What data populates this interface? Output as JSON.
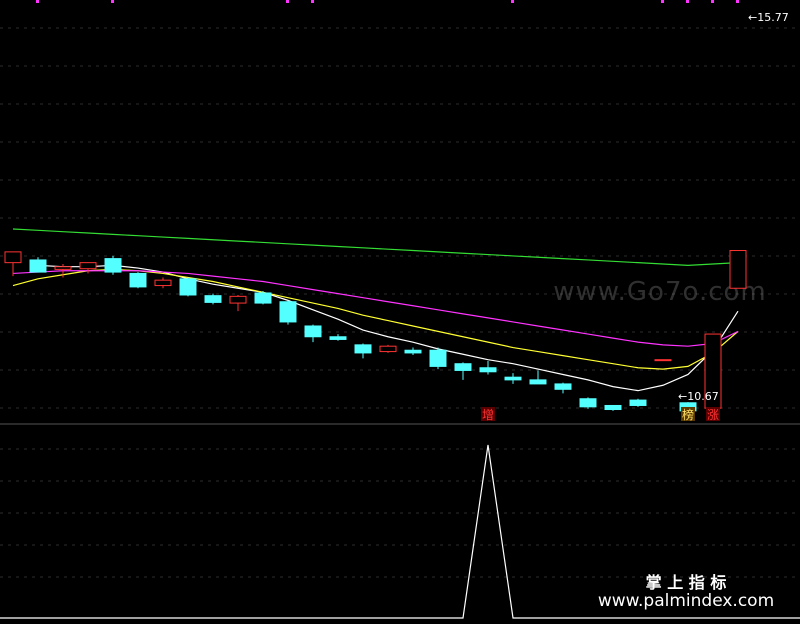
{
  "watermark": {
    "text": "www.Go7o.com"
  },
  "brand": {
    "name": "掌 上 指 标",
    "url": "www.palmindex.com"
  },
  "chart_data": [
    {
      "type": "candlestick",
      "panel": "price",
      "up_color": "#ff3333",
      "down_color": "#54ffff",
      "ylim": [
        10.2,
        15.9
      ],
      "x": [
        1,
        2,
        3,
        4,
        5,
        6,
        7,
        8,
        9,
        10,
        11,
        12,
        13,
        14,
        15,
        16,
        17,
        18,
        19,
        20,
        21,
        22,
        23,
        24,
        25,
        26,
        27,
        28,
        29,
        30
      ],
      "candles": [
        {
          "o": 12.12,
          "h": 12.2,
          "l": 11.92,
          "c": 12.28
        },
        {
          "o": 12.16,
          "h": 12.2,
          "l": 11.98,
          "c": 11.98
        },
        {
          "o": 12.02,
          "h": 12.1,
          "l": 11.9,
          "c": 12.06
        },
        {
          "o": 12.03,
          "h": 12.12,
          "l": 11.96,
          "c": 12.12
        },
        {
          "o": 12.18,
          "h": 12.22,
          "l": 11.94,
          "c": 11.98
        },
        {
          "o": 11.96,
          "h": 11.98,
          "l": 11.74,
          "c": 11.76
        },
        {
          "o": 11.78,
          "h": 11.9,
          "l": 11.74,
          "c": 11.86
        },
        {
          "o": 11.88,
          "h": 11.9,
          "l": 11.62,
          "c": 11.64
        },
        {
          "o": 11.63,
          "h": 11.66,
          "l": 11.5,
          "c": 11.53
        },
        {
          "o": 11.52,
          "h": 11.64,
          "l": 11.4,
          "c": 11.62
        },
        {
          "o": 11.67,
          "h": 11.7,
          "l": 11.5,
          "c": 11.52
        },
        {
          "o": 11.54,
          "h": 11.56,
          "l": 11.2,
          "c": 11.24
        },
        {
          "o": 11.18,
          "h": 11.2,
          "l": 10.94,
          "c": 11.02
        },
        {
          "o": 11.02,
          "h": 11.06,
          "l": 10.96,
          "c": 10.98
        },
        {
          "o": 10.9,
          "h": 10.92,
          "l": 10.7,
          "c": 10.78
        },
        {
          "o": 10.8,
          "h": 10.9,
          "l": 10.78,
          "c": 10.88
        },
        {
          "o": 10.82,
          "h": 10.86,
          "l": 10.75,
          "c": 10.78
        },
        {
          "o": 10.82,
          "h": 10.86,
          "l": 10.54,
          "c": 10.58
        },
        {
          "o": 10.62,
          "h": 10.64,
          "l": 10.38,
          "c": 10.52
        },
        {
          "o": 10.56,
          "h": 10.66,
          "l": 10.46,
          "c": 10.5
        },
        {
          "o": 10.42,
          "h": 10.48,
          "l": 10.32,
          "c": 10.38
        },
        {
          "o": 10.38,
          "h": 10.52,
          "l": 10.32,
          "c": 10.32
        },
        {
          "o": 10.32,
          "h": 10.34,
          "l": 10.18,
          "c": 10.24
        },
        {
          "o": 10.1,
          "h": 10.12,
          "l": 9.95,
          "c": 9.98
        },
        {
          "o": 10.0,
          "h": 10.0,
          "l": 9.92,
          "c": 9.94
        },
        {
          "o": 10.08,
          "h": 10.1,
          "l": 9.98,
          "c": 10.0
        },
        {
          "o": 10.68,
          "h": 10.68,
          "l": 10.67,
          "c": 10.68
        },
        {
          "o": 10.04,
          "h": 10.05,
          "l": 9.9,
          "c": 9.92
        },
        {
          "o": 9.96,
          "h": 11.06,
          "l": 9.98,
          "c": 11.06
        },
        {
          "o": 11.74,
          "h": 12.3,
          "l": 11.74,
          "c": 12.3
        }
      ],
      "annotations": [
        {
          "text": "10.67",
          "x": 27.6,
          "y": 10.14
        },
        {
          "text": "15.77",
          "x": 30.4,
          "y": 15.77
        }
      ],
      "markers": [
        {
          "text": "增",
          "x": 20,
          "color": "#ff3333",
          "bg": "#5a0000"
        },
        {
          "text": "榜",
          "x": 28,
          "color": "#ffe066",
          "bg": "#5a3a00"
        },
        {
          "text": "涨",
          "x": 29,
          "color": "#ff3333",
          "bg": "#5a0000"
        }
      ],
      "lines": [
        {
          "color": "#ffffff",
          "values": [
            null,
            12.08,
            12.06,
            12.06,
            12.08,
            12.04,
            11.98,
            11.88,
            11.8,
            11.74,
            11.68,
            11.56,
            11.42,
            11.28,
            11.12,
            11.02,
            10.94,
            10.84,
            10.76,
            10.68,
            10.62,
            10.54,
            10.46,
            10.38,
            10.28,
            10.22,
            10.3,
            10.46,
            10.82,
            11.4
          ]
        },
        {
          "color": "#ffff33",
          "values": [
            11.78,
            11.88,
            11.94,
            12.0,
            12.02,
            12.0,
            11.96,
            11.9,
            11.84,
            11.76,
            11.68,
            11.6,
            11.52,
            11.44,
            11.34,
            11.26,
            11.18,
            11.1,
            11.02,
            10.94,
            10.86,
            10.8,
            10.74,
            10.68,
            10.62,
            10.56,
            10.54,
            10.58,
            10.78,
            11.1
          ]
        },
        {
          "color": "#ff33ff",
          "values": [
            11.96,
            11.98,
            12.0,
            12.0,
            12.0,
            12.0,
            11.98,
            11.96,
            11.92,
            11.88,
            11.84,
            11.78,
            11.72,
            11.66,
            11.6,
            11.54,
            11.48,
            11.42,
            11.36,
            11.3,
            11.24,
            11.18,
            11.12,
            11.06,
            11.0,
            10.94,
            10.9,
            10.88,
            10.92,
            11.1
          ]
        },
        {
          "color": "#33dd33",
          "values": [
            12.62,
            12.6,
            12.58,
            12.56,
            12.54,
            12.52,
            12.5,
            12.48,
            12.46,
            12.44,
            12.42,
            12.4,
            12.38,
            12.36,
            12.34,
            12.32,
            12.3,
            12.28,
            12.26,
            12.24,
            12.22,
            12.2,
            12.18,
            12.16,
            12.14,
            12.12,
            12.1,
            12.08,
            12.1,
            12.12
          ]
        }
      ]
    },
    {
      "type": "line",
      "panel": "indicator",
      "color": "#ffffff",
      "ylim": [
        0,
        1
      ],
      "x": [
        1,
        2,
        3,
        4,
        5,
        6,
        7,
        8,
        9,
        10,
        11,
        12,
        13,
        14,
        15,
        16,
        17,
        18,
        19,
        20,
        21,
        22,
        23,
        24,
        25,
        26,
        27,
        28,
        29,
        30
      ],
      "values": [
        0,
        0,
        0,
        0,
        0,
        0,
        0,
        0,
        0,
        0,
        0,
        0,
        0,
        0,
        0,
        0,
        0,
        0,
        0,
        1,
        0,
        0,
        0,
        0,
        0,
        0,
        0,
        0,
        0,
        0
      ]
    }
  ]
}
